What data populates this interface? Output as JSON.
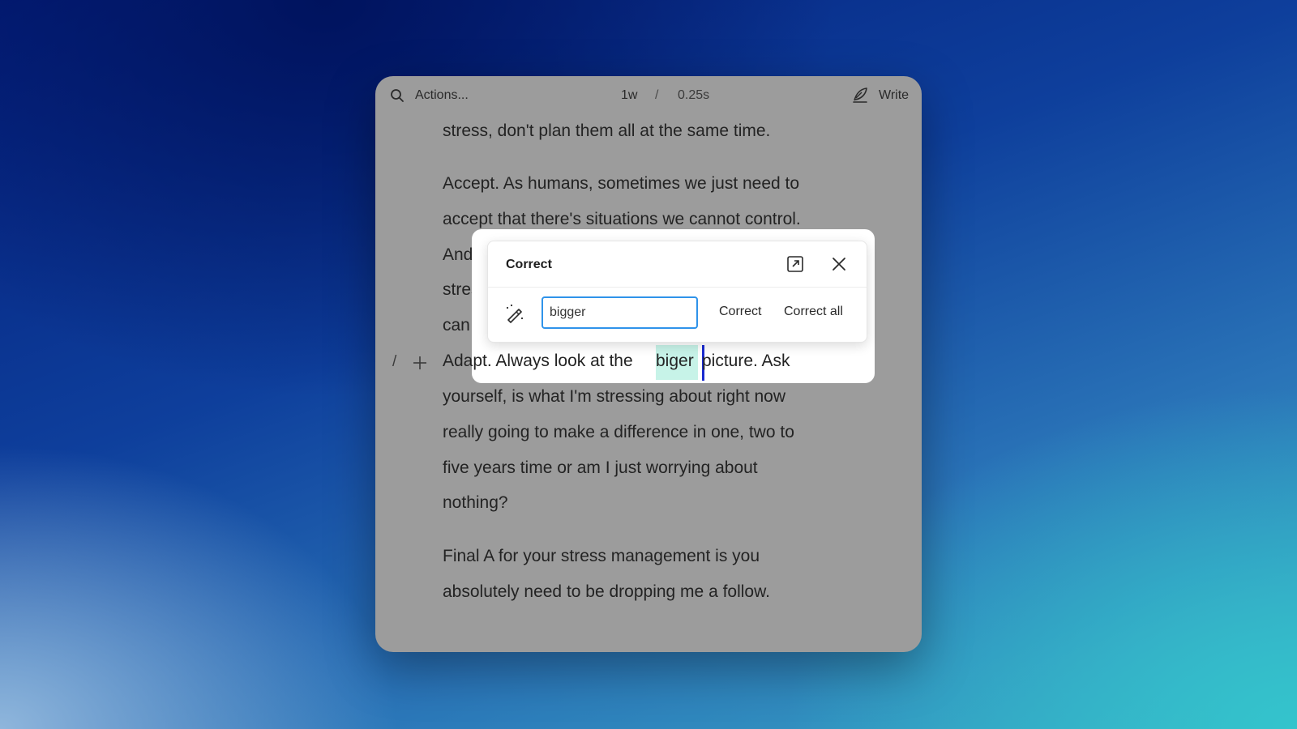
{
  "toolbar": {
    "actions_label": "Actions...",
    "word_count": "1w",
    "separator": "/",
    "elapsed": "0.25s",
    "write_label": "Write"
  },
  "document": {
    "lines": [
      "stress, don't plan them all at the same time.",
      "Accept. As humans, sometimes we just need to",
      "accept that there's situations we cannot control.",
      "And i",
      "stres",
      "can c"
    ],
    "adapt_lead": "Adapt. Always look at the ",
    "misspelled_word": "biger",
    "adapt_rest": "picture. Ask",
    "after_lines": [
      "yourself, is what I'm stressing about right now",
      "really going to make a difference in one, two to",
      "five years time or am I just worrying about",
      "nothing?",
      "Final A for your stress management is you",
      "absolutely need to be dropping me a follow."
    ],
    "gutter_slash": "/"
  },
  "correct_popup": {
    "title": "Correct",
    "input_value": "bigger",
    "correct_label": "Correct",
    "correct_all_label": "Correct all"
  },
  "icons": [
    "search-icon",
    "write-icon",
    "plus-icon",
    "expand-icon",
    "close-icon",
    "magic-wand-icon"
  ],
  "colors": {
    "highlight": "#c7f3e8",
    "input_border": "#2f93ea",
    "caret": "#1a2bd0"
  }
}
